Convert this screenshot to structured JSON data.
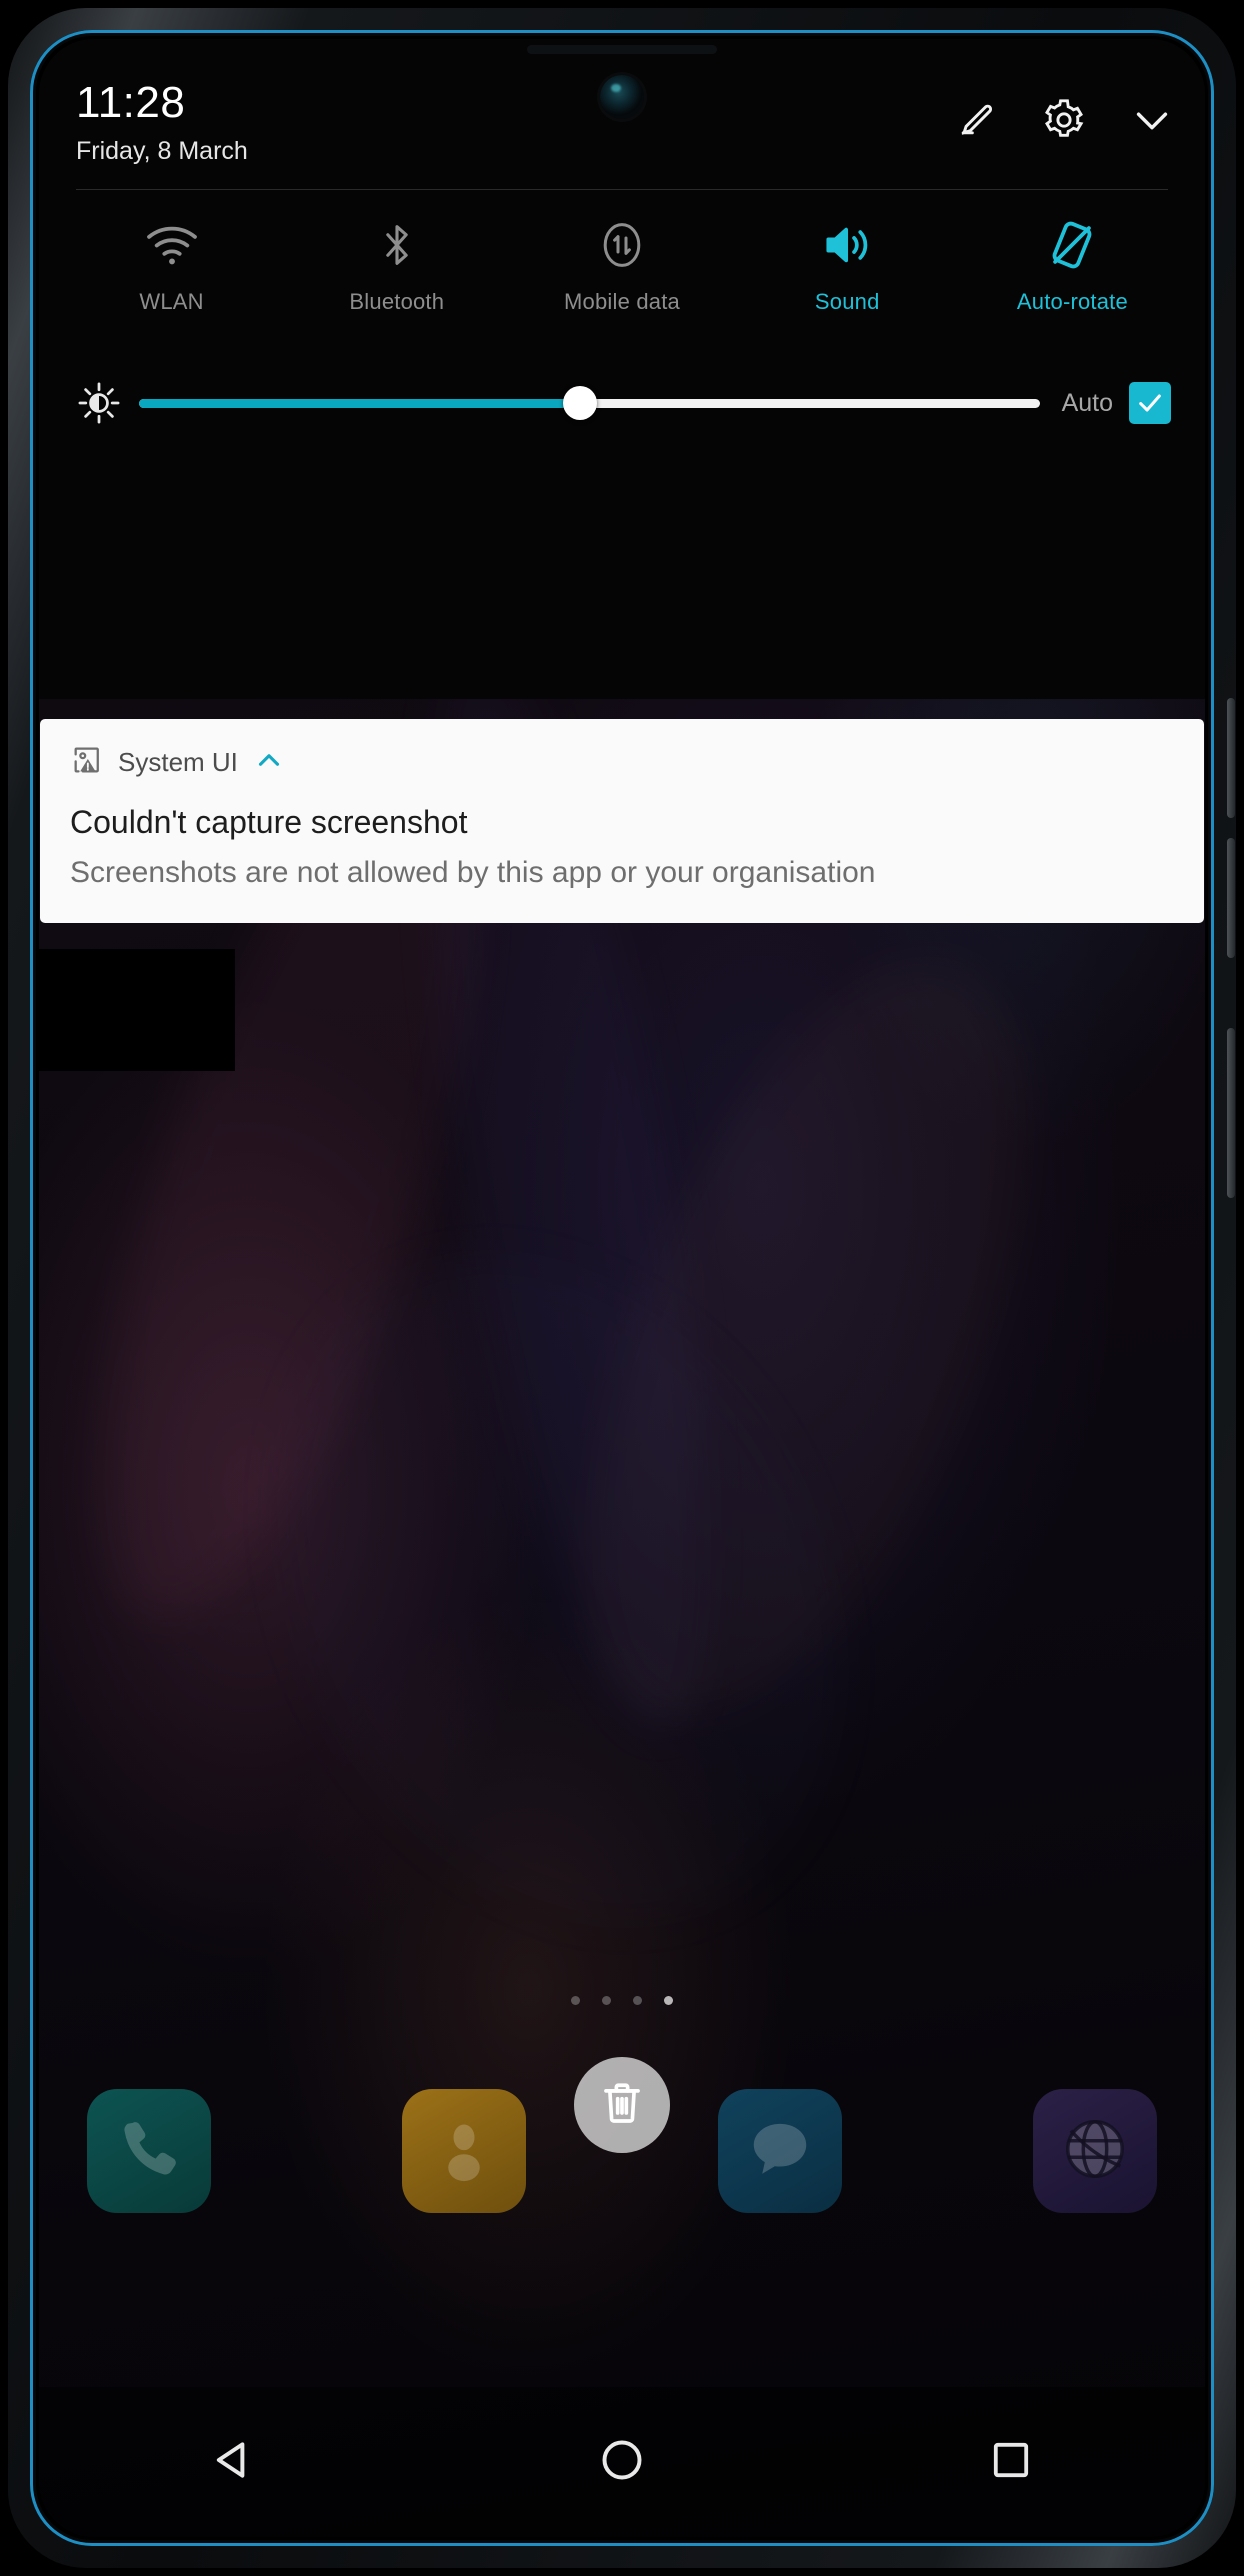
{
  "status_bar": {
    "time": "11:28",
    "date": "Friday, 8 March"
  },
  "shade_actions": [
    {
      "name": "edit-icon",
      "label": "Edit"
    },
    {
      "name": "settings-icon",
      "label": "Settings"
    },
    {
      "name": "chevron-down-icon",
      "label": "Collapse"
    }
  ],
  "quick_settings": {
    "toggles": [
      {
        "label": "WLAN",
        "icon": "wifi-icon",
        "state": "off"
      },
      {
        "label": "Bluetooth",
        "icon": "bluetooth-icon",
        "state": "off"
      },
      {
        "label": "Mobile data",
        "icon": "mobile-data-icon",
        "state": "off"
      },
      {
        "label": "Sound",
        "icon": "sound-icon",
        "state": "on"
      },
      {
        "label": "Auto-rotate",
        "icon": "auto-rotate-icon",
        "state": "on"
      }
    ],
    "brightness": {
      "icon": "brightness-icon",
      "value_percent": 49,
      "auto_label": "Auto",
      "auto_checked": true
    },
    "accent_color": "#1ec1d8",
    "inactive_color": "#8e8e8e"
  },
  "notification": {
    "app_icon": "image-warning-icon",
    "app_name": "System UI",
    "expand_icon": "chevron-up-icon",
    "title": "Couldn't capture screenshot",
    "body": "Screenshots are not allowed by this app or your organisation",
    "background_color": "#fafafa",
    "chevron_color": "#12a9c4"
  },
  "home_screen": {
    "page_dots": {
      "count": 4,
      "active_index": 3
    },
    "trash_button": {
      "icon": "trash-icon",
      "label": "Remove"
    },
    "dock": [
      {
        "name": "phone-app",
        "label": "Phone",
        "icon": "phone-icon",
        "color": "#0b4a48"
      },
      {
        "name": "contacts-app",
        "label": "Contacts",
        "icon": "contact-icon",
        "color": "#8a6414"
      },
      {
        "name": "messages-app",
        "label": "Messages",
        "icon": "message-icon",
        "color": "#0e3a52"
      },
      {
        "name": "browser-app",
        "label": "Browser",
        "icon": "globe-icon",
        "color": "#241a3c"
      }
    ]
  },
  "navigation_bar": [
    {
      "name": "back-button",
      "label": "Back",
      "icon": "triangle-back-icon"
    },
    {
      "name": "home-button",
      "label": "Home",
      "icon": "circle-home-icon"
    },
    {
      "name": "recents-button",
      "label": "Recents",
      "icon": "square-recents-icon"
    }
  ]
}
